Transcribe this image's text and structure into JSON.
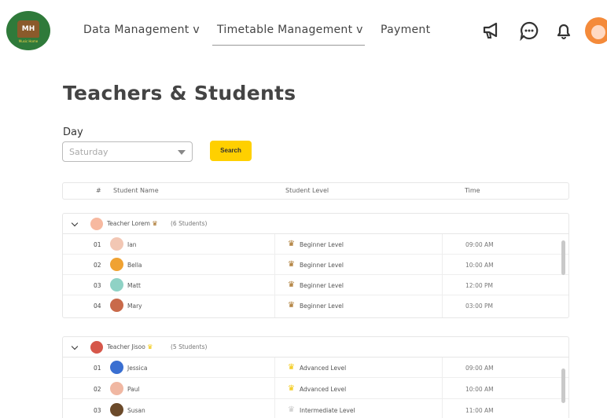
{
  "logo": {
    "initials": "MH",
    "tagline": "Music Home"
  },
  "nav": {
    "data_management": "Data Management v",
    "timetable_management": "Timetable Management v",
    "payment": "Payment"
  },
  "page_title": "Teachers & Students",
  "filter": {
    "day_label": "Day",
    "day_value": "Saturday",
    "search_label": "Search"
  },
  "table": {
    "headers": {
      "num": "#",
      "student_name": "Student Name",
      "student_level": "Student Level",
      "time": "Time"
    }
  },
  "groups": [
    {
      "teacher": "Teacher Lorem",
      "count": "(6 Students)",
      "rows": [
        {
          "num": "01",
          "name": "Ian",
          "level": "Beginner Level",
          "time": "09:00 AM"
        },
        {
          "num": "02",
          "name": "Bella",
          "level": "Beginner Level",
          "time": "10:00 AM"
        },
        {
          "num": "03",
          "name": "Matt",
          "level": "Beginner Level",
          "time": "12:00 PM"
        },
        {
          "num": "04",
          "name": "Mary",
          "level": "Beginner Level",
          "time": "03:00 PM"
        }
      ]
    },
    {
      "teacher": "Teacher Jisoo",
      "count": "(5 Students)",
      "rows": [
        {
          "num": "01",
          "name": "Jessica",
          "level": "Advanced Level",
          "time": "09:00 AM"
        },
        {
          "num": "02",
          "name": "Paul",
          "level": "Advanced Level",
          "time": "10:00 AM"
        },
        {
          "num": "03",
          "name": "Susan",
          "level": "Intermediate Level",
          "time": "11:00 AM"
        }
      ]
    }
  ],
  "icons": {
    "header": [
      "megaphone-icon",
      "chat-icon",
      "bell-icon"
    ],
    "level": "crown-icon"
  },
  "colors": {
    "accent": "#ffd000",
    "beginner_crown": "#a36a1b",
    "advanced_crown": "#f2c500",
    "intermediate_crown": "#c8c8c8"
  }
}
